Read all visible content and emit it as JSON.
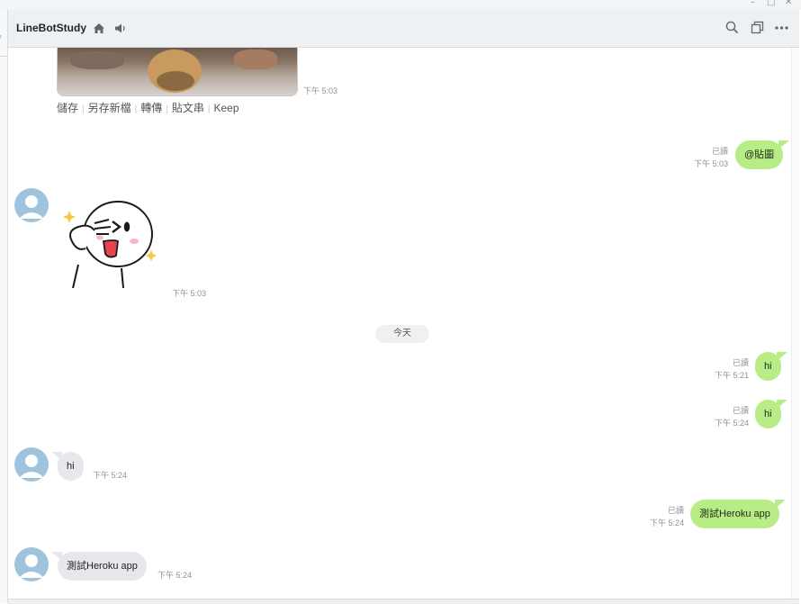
{
  "window": {
    "minimize_glyph": "–",
    "restore_glyph": "□",
    "close_glyph": "✕"
  },
  "header": {
    "title": "LineBotStudy",
    "icons": [
      "home-icon",
      "speaker-icon",
      "search-icon",
      "copy-icon",
      "more-icon"
    ]
  },
  "photo_message": {
    "actions": [
      "儲存",
      "另存新檔",
      "轉傳",
      "貼文串",
      "Keep"
    ],
    "time": "下午 5:03"
  },
  "messages": [
    {
      "side": "out",
      "text": "@貼圖",
      "read": "已讀",
      "time": "下午 5:03"
    },
    {
      "side": "in",
      "type": "sticker",
      "sticker": "moon-salute-sticker",
      "time": "下午 5:03"
    },
    {
      "side": "out",
      "text": "hi",
      "read": "已讀",
      "time": "下午 5:21"
    },
    {
      "side": "out",
      "text": "hi",
      "read": "已讀",
      "time": "下午 5:24"
    },
    {
      "side": "in",
      "text": "hi",
      "time": "下午 5:24"
    },
    {
      "side": "out",
      "text": "測試Heroku app",
      "read": "已讀",
      "time": "下午 5:24"
    },
    {
      "side": "in",
      "text": "測試Heroku app",
      "time": "下午 5:24"
    }
  ],
  "date_separator": "今天",
  "colors": {
    "outgoing_bubble": "#b7ec86",
    "incoming_bubble": "#e6e8eb",
    "header_bg": "#eef1f4",
    "avatar_bg": "#9fc3dc"
  }
}
